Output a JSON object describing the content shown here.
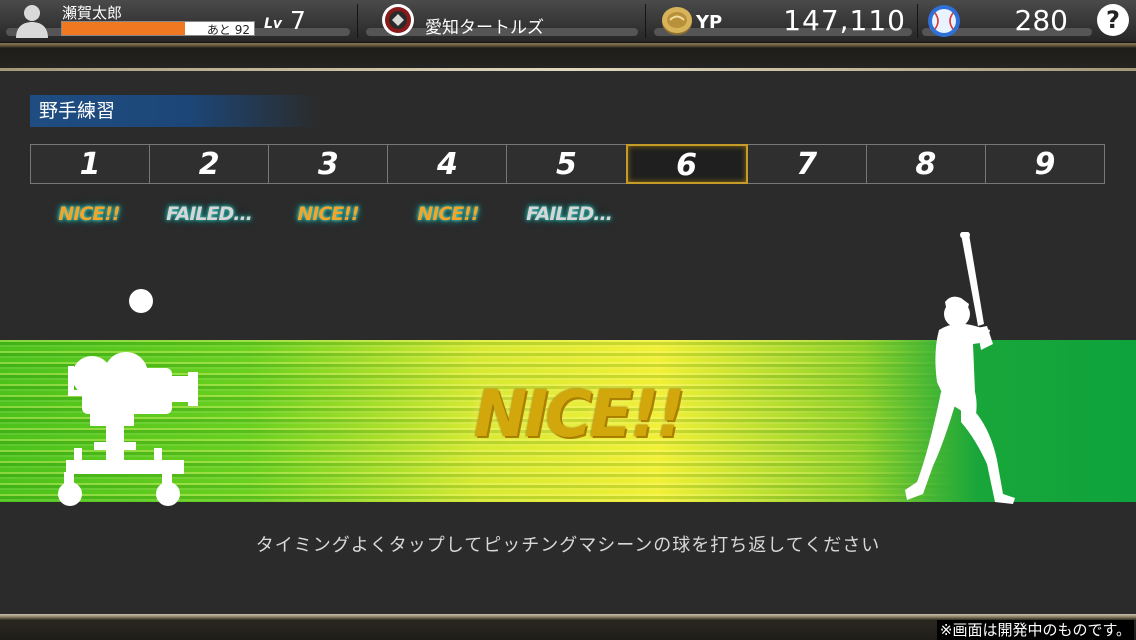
{
  "header": {
    "player_name": "瀬賀太郎",
    "exp_remaining": "あと 92",
    "exp_progress": 0.64,
    "level_label": "Lv",
    "level": "7",
    "team_name": "愛知タートルズ",
    "currency_label": "YP",
    "currency_value": "147,110",
    "ball_count": "280",
    "help_label": "?",
    "icons": {
      "avatar": "user-silhouette-icon",
      "team": "team-logo",
      "coin": "yp-coin-icon",
      "ball": "baseball-icon",
      "help": "help-icon"
    }
  },
  "section": {
    "title": "野手練習"
  },
  "innings": [
    "1",
    "2",
    "3",
    "4",
    "5",
    "6",
    "7",
    "8",
    "9"
  ],
  "active_inning": 6,
  "results": [
    "NICE!!",
    "FAILED...",
    "NICE!!",
    "NICE!!",
    "FAILED..."
  ],
  "current_result": "NICE!!",
  "instruction": "タイミングよくタップしてピッチングマシーンの球を打ち返してください",
  "footer_note": "※画面は開発中のものです。",
  "colors": {
    "nice": "#f2a52a",
    "failed": "#d6d6d6",
    "active_tab_border": "#c69b2a",
    "exp_bar": "#f07820",
    "big_result": "#d2a70c"
  }
}
